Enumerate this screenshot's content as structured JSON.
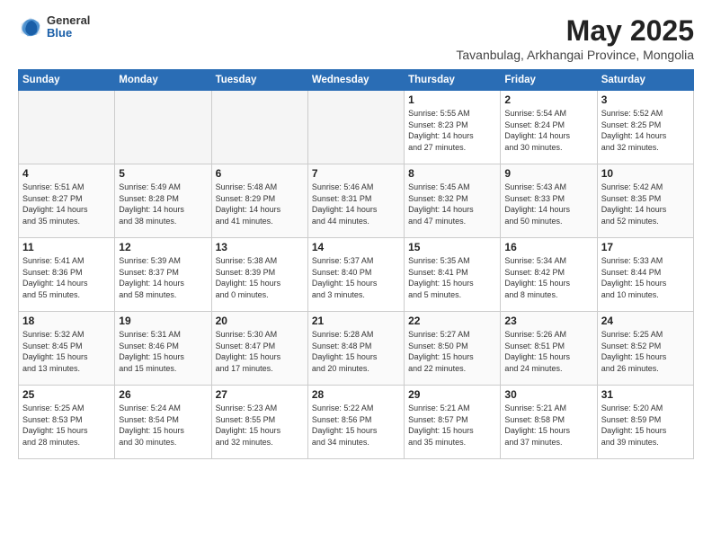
{
  "header": {
    "logo": {
      "general": "General",
      "blue": "Blue"
    },
    "title": "May 2025",
    "location": "Tavanbulag, Arkhangai Province, Mongolia"
  },
  "weekdays": [
    "Sunday",
    "Monday",
    "Tuesday",
    "Wednesday",
    "Thursday",
    "Friday",
    "Saturday"
  ],
  "weeks": [
    [
      {
        "day": "",
        "info": ""
      },
      {
        "day": "",
        "info": ""
      },
      {
        "day": "",
        "info": ""
      },
      {
        "day": "",
        "info": ""
      },
      {
        "day": "1",
        "info": "Sunrise: 5:55 AM\nSunset: 8:23 PM\nDaylight: 14 hours\nand 27 minutes."
      },
      {
        "day": "2",
        "info": "Sunrise: 5:54 AM\nSunset: 8:24 PM\nDaylight: 14 hours\nand 30 minutes."
      },
      {
        "day": "3",
        "info": "Sunrise: 5:52 AM\nSunset: 8:25 PM\nDaylight: 14 hours\nand 32 minutes."
      }
    ],
    [
      {
        "day": "4",
        "info": "Sunrise: 5:51 AM\nSunset: 8:27 PM\nDaylight: 14 hours\nand 35 minutes."
      },
      {
        "day": "5",
        "info": "Sunrise: 5:49 AM\nSunset: 8:28 PM\nDaylight: 14 hours\nand 38 minutes."
      },
      {
        "day": "6",
        "info": "Sunrise: 5:48 AM\nSunset: 8:29 PM\nDaylight: 14 hours\nand 41 minutes."
      },
      {
        "day": "7",
        "info": "Sunrise: 5:46 AM\nSunset: 8:31 PM\nDaylight: 14 hours\nand 44 minutes."
      },
      {
        "day": "8",
        "info": "Sunrise: 5:45 AM\nSunset: 8:32 PM\nDaylight: 14 hours\nand 47 minutes."
      },
      {
        "day": "9",
        "info": "Sunrise: 5:43 AM\nSunset: 8:33 PM\nDaylight: 14 hours\nand 50 minutes."
      },
      {
        "day": "10",
        "info": "Sunrise: 5:42 AM\nSunset: 8:35 PM\nDaylight: 14 hours\nand 52 minutes."
      }
    ],
    [
      {
        "day": "11",
        "info": "Sunrise: 5:41 AM\nSunset: 8:36 PM\nDaylight: 14 hours\nand 55 minutes."
      },
      {
        "day": "12",
        "info": "Sunrise: 5:39 AM\nSunset: 8:37 PM\nDaylight: 14 hours\nand 58 minutes."
      },
      {
        "day": "13",
        "info": "Sunrise: 5:38 AM\nSunset: 8:39 PM\nDaylight: 15 hours\nand 0 minutes."
      },
      {
        "day": "14",
        "info": "Sunrise: 5:37 AM\nSunset: 8:40 PM\nDaylight: 15 hours\nand 3 minutes."
      },
      {
        "day": "15",
        "info": "Sunrise: 5:35 AM\nSunset: 8:41 PM\nDaylight: 15 hours\nand 5 minutes."
      },
      {
        "day": "16",
        "info": "Sunrise: 5:34 AM\nSunset: 8:42 PM\nDaylight: 15 hours\nand 8 minutes."
      },
      {
        "day": "17",
        "info": "Sunrise: 5:33 AM\nSunset: 8:44 PM\nDaylight: 15 hours\nand 10 minutes."
      }
    ],
    [
      {
        "day": "18",
        "info": "Sunrise: 5:32 AM\nSunset: 8:45 PM\nDaylight: 15 hours\nand 13 minutes."
      },
      {
        "day": "19",
        "info": "Sunrise: 5:31 AM\nSunset: 8:46 PM\nDaylight: 15 hours\nand 15 minutes."
      },
      {
        "day": "20",
        "info": "Sunrise: 5:30 AM\nSunset: 8:47 PM\nDaylight: 15 hours\nand 17 minutes."
      },
      {
        "day": "21",
        "info": "Sunrise: 5:28 AM\nSunset: 8:48 PM\nDaylight: 15 hours\nand 20 minutes."
      },
      {
        "day": "22",
        "info": "Sunrise: 5:27 AM\nSunset: 8:50 PM\nDaylight: 15 hours\nand 22 minutes."
      },
      {
        "day": "23",
        "info": "Sunrise: 5:26 AM\nSunset: 8:51 PM\nDaylight: 15 hours\nand 24 minutes."
      },
      {
        "day": "24",
        "info": "Sunrise: 5:25 AM\nSunset: 8:52 PM\nDaylight: 15 hours\nand 26 minutes."
      }
    ],
    [
      {
        "day": "25",
        "info": "Sunrise: 5:25 AM\nSunset: 8:53 PM\nDaylight: 15 hours\nand 28 minutes."
      },
      {
        "day": "26",
        "info": "Sunrise: 5:24 AM\nSunset: 8:54 PM\nDaylight: 15 hours\nand 30 minutes."
      },
      {
        "day": "27",
        "info": "Sunrise: 5:23 AM\nSunset: 8:55 PM\nDaylight: 15 hours\nand 32 minutes."
      },
      {
        "day": "28",
        "info": "Sunrise: 5:22 AM\nSunset: 8:56 PM\nDaylight: 15 hours\nand 34 minutes."
      },
      {
        "day": "29",
        "info": "Sunrise: 5:21 AM\nSunset: 8:57 PM\nDaylight: 15 hours\nand 35 minutes."
      },
      {
        "day": "30",
        "info": "Sunrise: 5:21 AM\nSunset: 8:58 PM\nDaylight: 15 hours\nand 37 minutes."
      },
      {
        "day": "31",
        "info": "Sunrise: 5:20 AM\nSunset: 8:59 PM\nDaylight: 15 hours\nand 39 minutes."
      }
    ]
  ]
}
